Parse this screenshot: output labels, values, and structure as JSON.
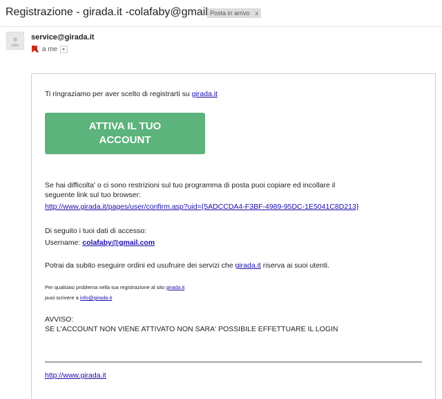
{
  "header": {
    "subject": "Registrazione - girada.it -colafaby@gmail.com",
    "label": "Posta in arrivo",
    "label_close": "x"
  },
  "message": {
    "sender": "service@girada.it",
    "recipient": "a me"
  },
  "body": {
    "thanks_text": "Ti ringraziamo per aver scelto di registrarti su ",
    "thanks_link": "girada.it",
    "cta_line1": "ATTIVA IL TUO",
    "cta_line2": "ACCOUNT",
    "trouble_line1": "Se hai difficolta' o ci sono restrizioni sul tuo programma di posta puoi copiare ed incollare il",
    "trouble_line2": "seguente link sul tuo browser:",
    "confirm_link": "http://www.girada.it/pages/user/confirm.asp?uid={5ADCCDA4-F3BF-4989-95DC-1E5041C8D213}",
    "access_heading": "Di seguito i tuoi dati di accesso:",
    "username_label": "Username: ",
    "username_value": "colafaby@gmail.com",
    "services_text": "Potrai da subito eseguire ordini ed usufruire dei servizi che ",
    "services_link": "girada.it",
    "services_tail": " riserva ai suoi utenti.",
    "problem_text": "Per qualsiasi problema nella tua registrazione al sito ",
    "problem_link": "girada.it",
    "write_text": "puoi scrivere a ",
    "write_link": "info@girada.it",
    "warning_title": "AVVISO:",
    "warning_text": "SE L'ACCOUNT NON VIENE ATTIVATO NON SARA' POSSIBILE EFFETTUARE IL LOGIN",
    "footer_link": "http://www.girada.it"
  },
  "colors": {
    "cta": "#5cb37b",
    "link": "#1a0dab"
  },
  "icons": {
    "avatar": "person-icon",
    "importance": "importance-marker-icon",
    "dropdown": "chevron-down-icon"
  }
}
